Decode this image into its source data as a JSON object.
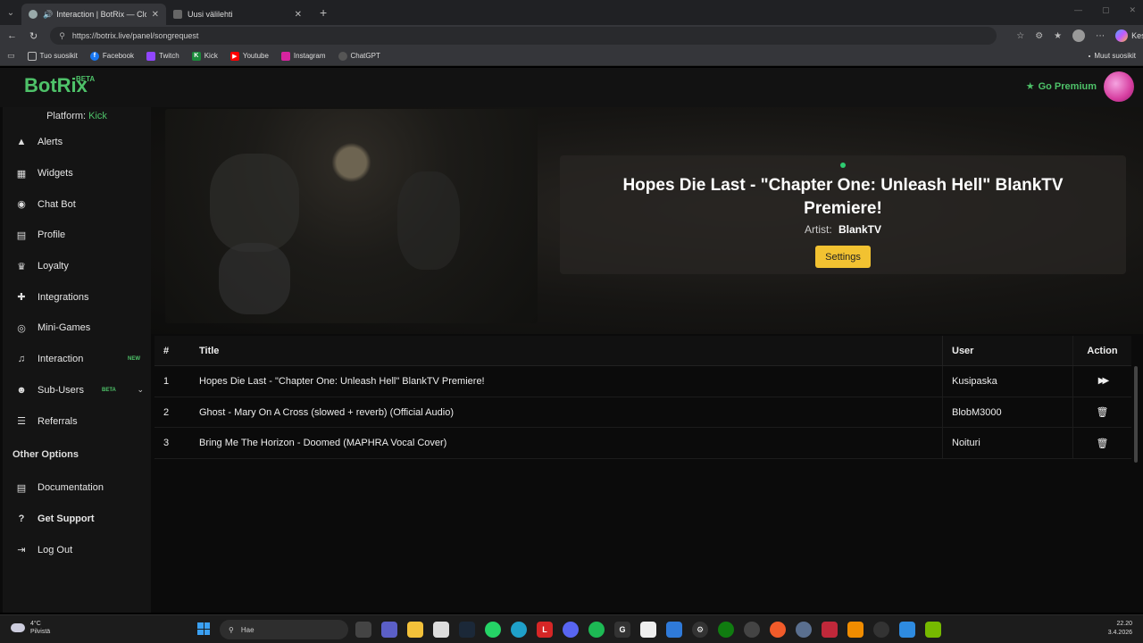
{
  "browser": {
    "tabs": [
      {
        "title": "Interaction | BotRix — Cloud",
        "active": true
      },
      {
        "title": "Uusi välilehti",
        "active": false
      }
    ],
    "url": "https://botrix.live/panel/songrequest",
    "profile_button": "Keskustelu",
    "bookmarks": [
      {
        "label": "Tuo suosikit",
        "icon": "folder-icon"
      },
      {
        "label": "Facebook",
        "icon": "facebook-icon",
        "color": "#1877f2"
      },
      {
        "label": "Twitch",
        "icon": "twitch-icon",
        "color": "#9146ff"
      },
      {
        "label": "Kick",
        "icon": "kick-icon",
        "color": "#1b8b3b"
      },
      {
        "label": "Youtube",
        "icon": "youtube-icon",
        "color": "#ff0000"
      },
      {
        "label": "Instagram",
        "icon": "instagram-icon",
        "color": "#d6249f"
      },
      {
        "label": "ChatGPT",
        "icon": "chatgpt-icon",
        "color": "#555555"
      }
    ],
    "other_bookmarks": "Muut suosikit"
  },
  "app": {
    "brand": "BotRix",
    "brand_badge": "BETA",
    "premium_label": "Go Premium",
    "accent": "#4ec269",
    "platform_label": "Platform:",
    "platform_value": "Kick",
    "nav": [
      {
        "label": "Alerts",
        "icon": "warning-icon"
      },
      {
        "label": "Widgets",
        "icon": "grid-icon"
      },
      {
        "label": "Chat Bot",
        "icon": "robot-icon"
      },
      {
        "label": "Profile",
        "icon": "id-card-icon"
      },
      {
        "label": "Loyalty",
        "icon": "trophy-icon"
      },
      {
        "label": "Integrations",
        "icon": "puzzle-icon"
      },
      {
        "label": "Mini-Games",
        "icon": "gamepad-icon"
      },
      {
        "label": "Interaction",
        "icon": "music-icon",
        "badge": "NEW"
      },
      {
        "label": "Sub-Users",
        "icon": "users-icon",
        "badge": "BETA"
      },
      {
        "label": "Referrals",
        "icon": "list-icon"
      }
    ],
    "other_options_heading": "Other Options",
    "other_nav": [
      {
        "label": "Documentation",
        "icon": "book-icon"
      },
      {
        "label": "Get Support",
        "icon": "question-icon"
      },
      {
        "label": "Log Out",
        "icon": "logout-icon"
      }
    ]
  },
  "now_playing": {
    "title": "Hopes Die Last - \"Chapter One: Unleash Hell\" BlankTV Premiere!",
    "artist_label": "Artist:",
    "artist": "BlankTV",
    "settings_label": "Settings"
  },
  "queue": {
    "headers": {
      "num": "#",
      "title": "Title",
      "user": "User",
      "action": "Action"
    },
    "rows": [
      {
        "num": "1",
        "title": "Hopes Die Last - \"Chapter One: Unleash Hell\" BlankTV Premiere!",
        "user": "Kusipaska",
        "action_icon": "skip-forward-icon"
      },
      {
        "num": "2",
        "title": "Ghost - Mary On A Cross (slowed + reverb) (Official Audio)",
        "user": "BlobM3000",
        "action_icon": "trash-icon"
      },
      {
        "num": "3",
        "title": "Bring Me The Horizon - Doomed (MAPHRA Vocal Cover)",
        "user": "Noituri",
        "action_icon": "trash-icon"
      }
    ]
  },
  "taskbar": {
    "temperature": "4°C",
    "weather": "Pilvistä",
    "search_placeholder": "Hae",
    "time": "22.20",
    "date": "3.4.2026"
  }
}
